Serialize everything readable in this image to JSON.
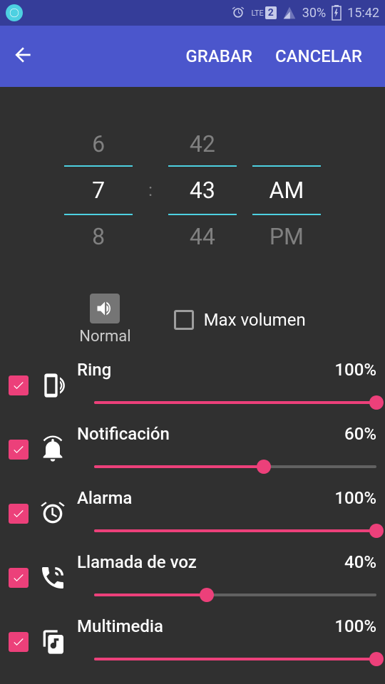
{
  "status_bar": {
    "battery_pct": "30%",
    "time": "15:42",
    "lte": "LTE",
    "sim": "2"
  },
  "app_bar": {
    "save_label": "GRABAR",
    "cancel_label": "CANCELAR"
  },
  "time_picker": {
    "hour_prev": "6",
    "hour_sel": "7",
    "hour_next": "8",
    "min_prev": "42",
    "min_sel": "43",
    "min_next": "44",
    "ampm_sel": "AM",
    "ampm_next": "PM",
    "colon": ":"
  },
  "mode": {
    "label": "Normal",
    "max_volume_label": "Max volumen",
    "max_volume_checked": false
  },
  "volumes": [
    {
      "name": "Ring",
      "pct": "100%",
      "value": 100,
      "checked": true,
      "icon": "phone-ring"
    },
    {
      "name": "Notificación",
      "pct": "60%",
      "value": 60,
      "checked": true,
      "icon": "bell"
    },
    {
      "name": "Alarma",
      "pct": "100%",
      "value": 100,
      "checked": true,
      "icon": "alarm"
    },
    {
      "name": "Llamada de voz",
      "pct": "40%",
      "value": 40,
      "checked": true,
      "icon": "phone-call"
    },
    {
      "name": "Multimedia",
      "pct": "100%",
      "value": 100,
      "checked": true,
      "icon": "music"
    }
  ],
  "colors": {
    "accent": "#ec407a",
    "app_bar": "#4b56cc",
    "status": "#353d99",
    "picker_border": "#4dd0e1"
  }
}
